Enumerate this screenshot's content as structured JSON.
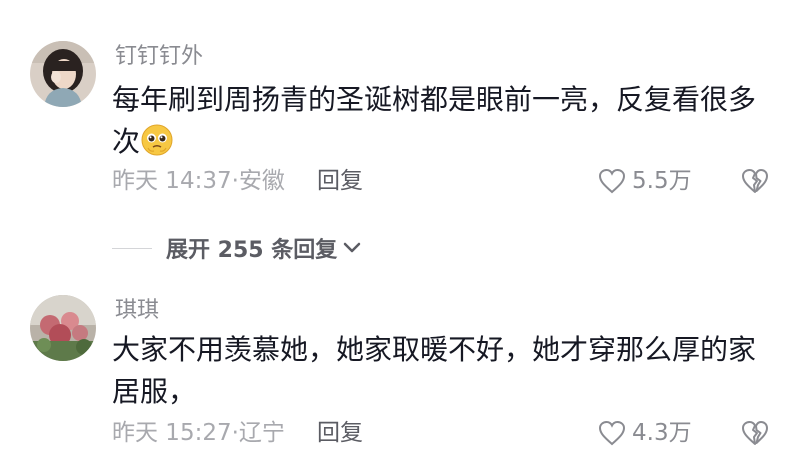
{
  "comments": [
    {
      "username": "钉钉钉外",
      "text_line1": "每年刷到周扬青的圣诞树都是眼前一亮，反复看很多",
      "text_line2": "次",
      "emoji": "pleading-face-icon",
      "time_location": "昨天 14:37·安徽",
      "reply_label": "回复",
      "likes": "5.5万"
    },
    {
      "username": "琪琪",
      "text_line1": "大家不用羡慕她，她家取暖不好，她才穿那么厚的家",
      "text_line2": "居服，",
      "time_location": "昨天 15:27·辽宁",
      "reply_label": "回复",
      "likes": "4.3万"
    }
  ],
  "expand_replies": {
    "label": "展开 255 条回复"
  },
  "colors": {
    "text": "#161823",
    "secondary": "#8a8b91",
    "muted": "#a8a9ae",
    "background": "#ffffff"
  }
}
